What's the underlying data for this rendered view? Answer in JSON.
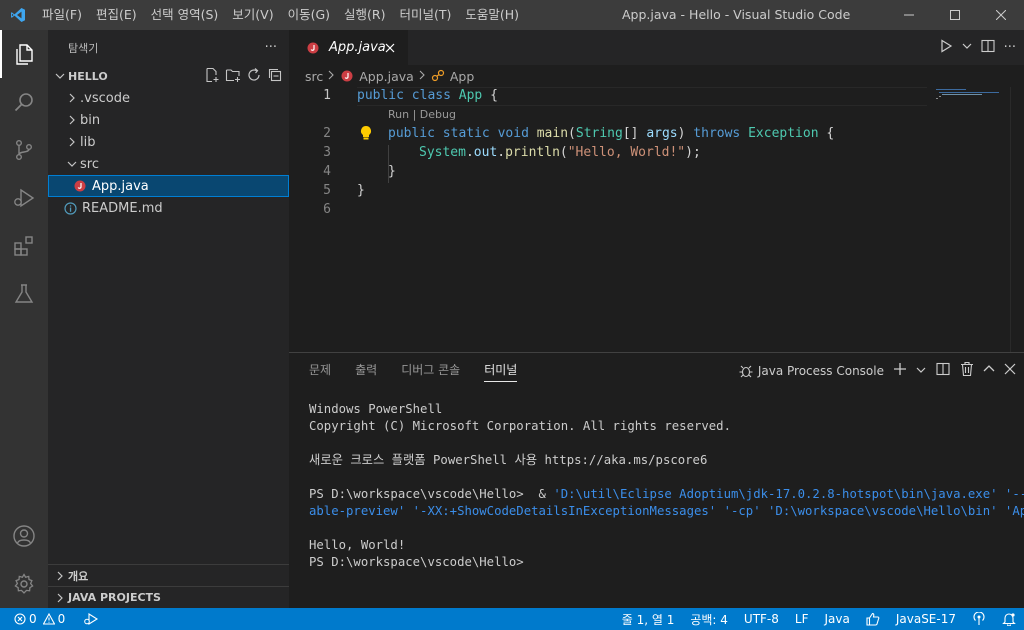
{
  "titlebar": {
    "menu": [
      "파일(F)",
      "편집(E)",
      "선택 영역(S)",
      "보기(V)",
      "이동(G)",
      "실행(R)",
      "터미널(T)",
      "도움말(H)"
    ],
    "window_title": "App.java - Hello - Visual Studio Code"
  },
  "sidebar": {
    "title": "탐색기",
    "more": "···",
    "project": "HELLO",
    "tree": [
      ".vscode",
      "bin",
      "lib",
      "src",
      "App.java",
      "README.md"
    ],
    "outline_label": "개요",
    "java_projects_label": "JAVA PROJECTS"
  },
  "editor": {
    "tab_label": "App.java",
    "breadcrumb": [
      "src",
      "App.java",
      "App"
    ],
    "line_numbers": [
      "1",
      "2",
      "3",
      "4",
      "5",
      "6"
    ],
    "codelens": "Run | Debug",
    "code": {
      "l1": {
        "kw1": "public",
        "kw2": "class",
        "type": "App",
        "rest": " {"
      },
      "l2": {
        "kw1": "public",
        "kw2": "static",
        "kw3": "void",
        "fn": "main",
        "p1": "(",
        "t1": "String",
        "p2": "[] ",
        "var": "args",
        "p3": ") ",
        "kw4": "throws",
        "t2": "Exception",
        "rest": " {"
      },
      "l3": {
        "t1": "System",
        "p1": ".",
        "v1": "out",
        "p2": ".",
        "fn": "println",
        "p3": "(",
        "str": "\"Hello, World!\"",
        "rest": ");"
      },
      "l4": "}",
      "l5": "}"
    }
  },
  "panel": {
    "tabs": [
      "문제",
      "출력",
      "디버그 콘솔",
      "터미널"
    ],
    "active_tab": "터미널",
    "console_name": "Java Process Console",
    "terminal": {
      "l1": "Windows PowerShell",
      "l2": "Copyright (C) Microsoft Corporation. All rights reserved.",
      "l3": "새로운 크로스 플랫폼 PowerShell 사용 https://aka.ms/pscore6",
      "l4_prompt": "PS D:\\workspace\\vscode\\Hello>  & ",
      "l4_args": "'D:\\util\\Eclipse Adoptium\\jdk-17.0.2.8-hotspot\\bin\\java.exe' '--en",
      "l5_args": "able-preview' '-XX:+ShowCodeDetailsInExceptionMessages' '-cp' 'D:\\workspace\\vscode\\Hello\\bin' 'App'",
      "l6": "Hello, World!",
      "l7": "PS D:\\workspace\\vscode\\Hello>"
    }
  },
  "statusbar": {
    "errors": "0",
    "warnings": "0",
    "position": "줄 1, 열 1",
    "spaces": "공백: 4",
    "encoding": "UTF-8",
    "eol": "LF",
    "language": "Java",
    "java_version": "JavaSE-17"
  },
  "colors": {
    "accent": "#007acc",
    "java_icon": "#cc3e44",
    "info_icon": "#519aba"
  }
}
